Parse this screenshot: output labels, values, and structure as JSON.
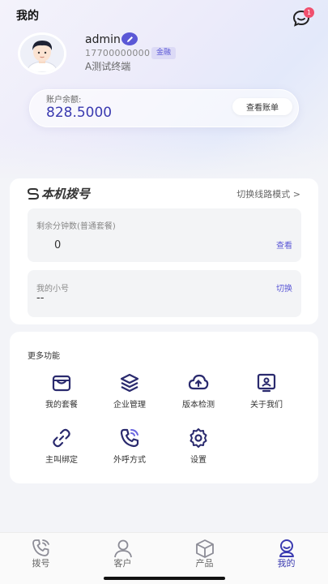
{
  "header": {
    "title": "我的",
    "message_badge": "1"
  },
  "profile": {
    "username": "admin",
    "phone": "17700000000",
    "tag": "金融",
    "organization": "A测试终端"
  },
  "balance": {
    "label": "账户余额:",
    "value": "828.5000",
    "bill_button": "查看账单"
  },
  "dial": {
    "title": "本机拨号",
    "switch_mode": "切换线路模式 >",
    "remaining": {
      "label": "剩余分钟数(普通套餐)",
      "value": "0",
      "link": "查看"
    },
    "extension": {
      "label": "我的小号",
      "value": "--",
      "link": "切换"
    }
  },
  "more": {
    "title": "更多功能",
    "items": [
      {
        "label": "我的套餐",
        "icon": "bag-icon"
      },
      {
        "label": "企业管理",
        "icon": "layers-icon"
      },
      {
        "label": "版本检测",
        "icon": "cloud-upload-icon"
      },
      {
        "label": "关于我们",
        "icon": "info-card-icon"
      },
      {
        "label": "主叫绑定",
        "icon": "link-icon"
      },
      {
        "label": "外呼方式",
        "icon": "phone-call-icon"
      },
      {
        "label": "设置",
        "icon": "gear-icon"
      }
    ]
  },
  "tabbar": {
    "active": "我的",
    "items": [
      {
        "label": "拨号",
        "icon": "dial-icon"
      },
      {
        "label": "客户",
        "icon": "customer-icon"
      },
      {
        "label": "产品",
        "icon": "box-icon"
      },
      {
        "label": "我的",
        "icon": "profile-icon"
      }
    ]
  },
  "colors": {
    "accent": "#5b58d6",
    "accent_dark": "#3a3ab0",
    "badge": "#f0506e"
  }
}
